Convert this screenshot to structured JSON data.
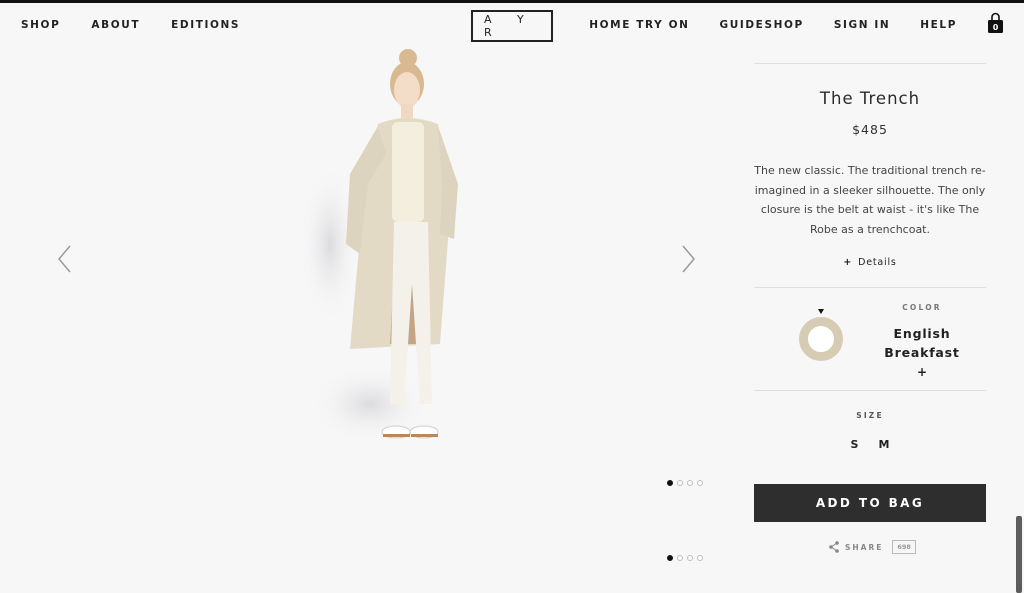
{
  "nav": {
    "left": [
      "SHOP",
      "ABOUT",
      "EDITIONS"
    ],
    "logo": "A Y R",
    "right": [
      "HOME TRY ON",
      "GUIDESHOP",
      "SIGN IN",
      "HELP"
    ],
    "bag_count": "0",
    "bag_icon": "shopping-bag-icon"
  },
  "gallery": {
    "prev_icon": "chevron-left-icon",
    "next_icon": "chevron-right-icon",
    "dots_total": 4,
    "active_dot": 1
  },
  "product": {
    "title": "The Trench",
    "price": "$485",
    "description": "The new classic. The traditional trench re-imagined in a sleeker silhouette. The only closure is the belt at waist - it's like The Robe as a trenchcoat.",
    "details_label": "Details",
    "details_icon": "plus-icon",
    "color_label": "COLOR",
    "color_name_line1": "English",
    "color_name_line2": "Breakfast",
    "color_more": "+",
    "swatch_color": "#d6ccb3",
    "size_label": "SIZE",
    "sizes": [
      "S",
      "M"
    ],
    "add_to_bag": "ADD TO BAG",
    "share_label": "SHARE",
    "share_count": "698"
  },
  "colors": {
    "button_bg": "#2e2e2e",
    "background": "#f7f7f8"
  }
}
